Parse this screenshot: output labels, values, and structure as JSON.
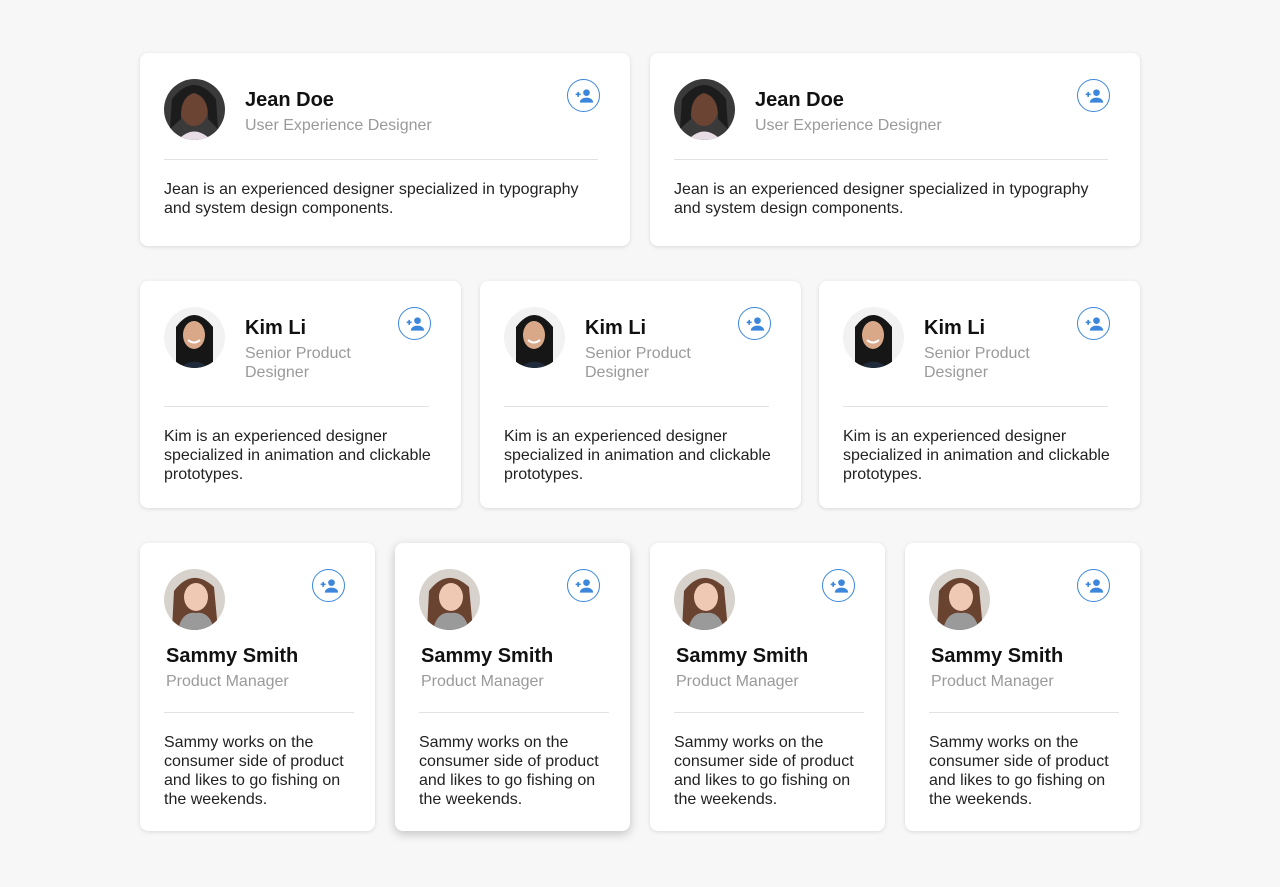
{
  "accent_color": "#3c87dc",
  "add_button_icon": "person-add-icon",
  "cards": [
    {
      "name": "Jean Doe",
      "role": "User Experience Designer",
      "bio": "Jean is an experienced designer specialized in typography and system design components."
    },
    {
      "name": "Jean Doe",
      "role": "User Experience Designer",
      "bio": "Jean is an experienced designer specialized in typography and system design components."
    },
    {
      "name": "Kim Li",
      "role": "Senior Product Designer",
      "bio": "Kim is an experienced designer specialized in animation and clickable prototypes."
    },
    {
      "name": "Kim Li",
      "role": "Senior Product Designer",
      "bio": "Kim is an experienced designer specialized in animation and clickable prototypes."
    },
    {
      "name": "Kim Li",
      "role": "Senior Product Designer",
      "bio": "Kim is an experienced designer specialized in animation and clickable prototypes."
    },
    {
      "name": "Sammy Smith",
      "role": "Product Manager",
      "bio": "Sammy works on the consumer side of product and likes to go fishing on the weekends."
    },
    {
      "name": "Sammy Smith",
      "role": "Product Manager",
      "bio": "Sammy works on the consumer side of product and likes to go fishing on the weekends."
    },
    {
      "name": "Sammy Smith",
      "role": "Product Manager",
      "bio": "Sammy works on the consumer side of product and likes to go fishing on the weekends."
    },
    {
      "name": "Sammy Smith",
      "role": "Product Manager",
      "bio": "Sammy works on the consumer side of product and likes to go fishing on the weekends."
    }
  ]
}
